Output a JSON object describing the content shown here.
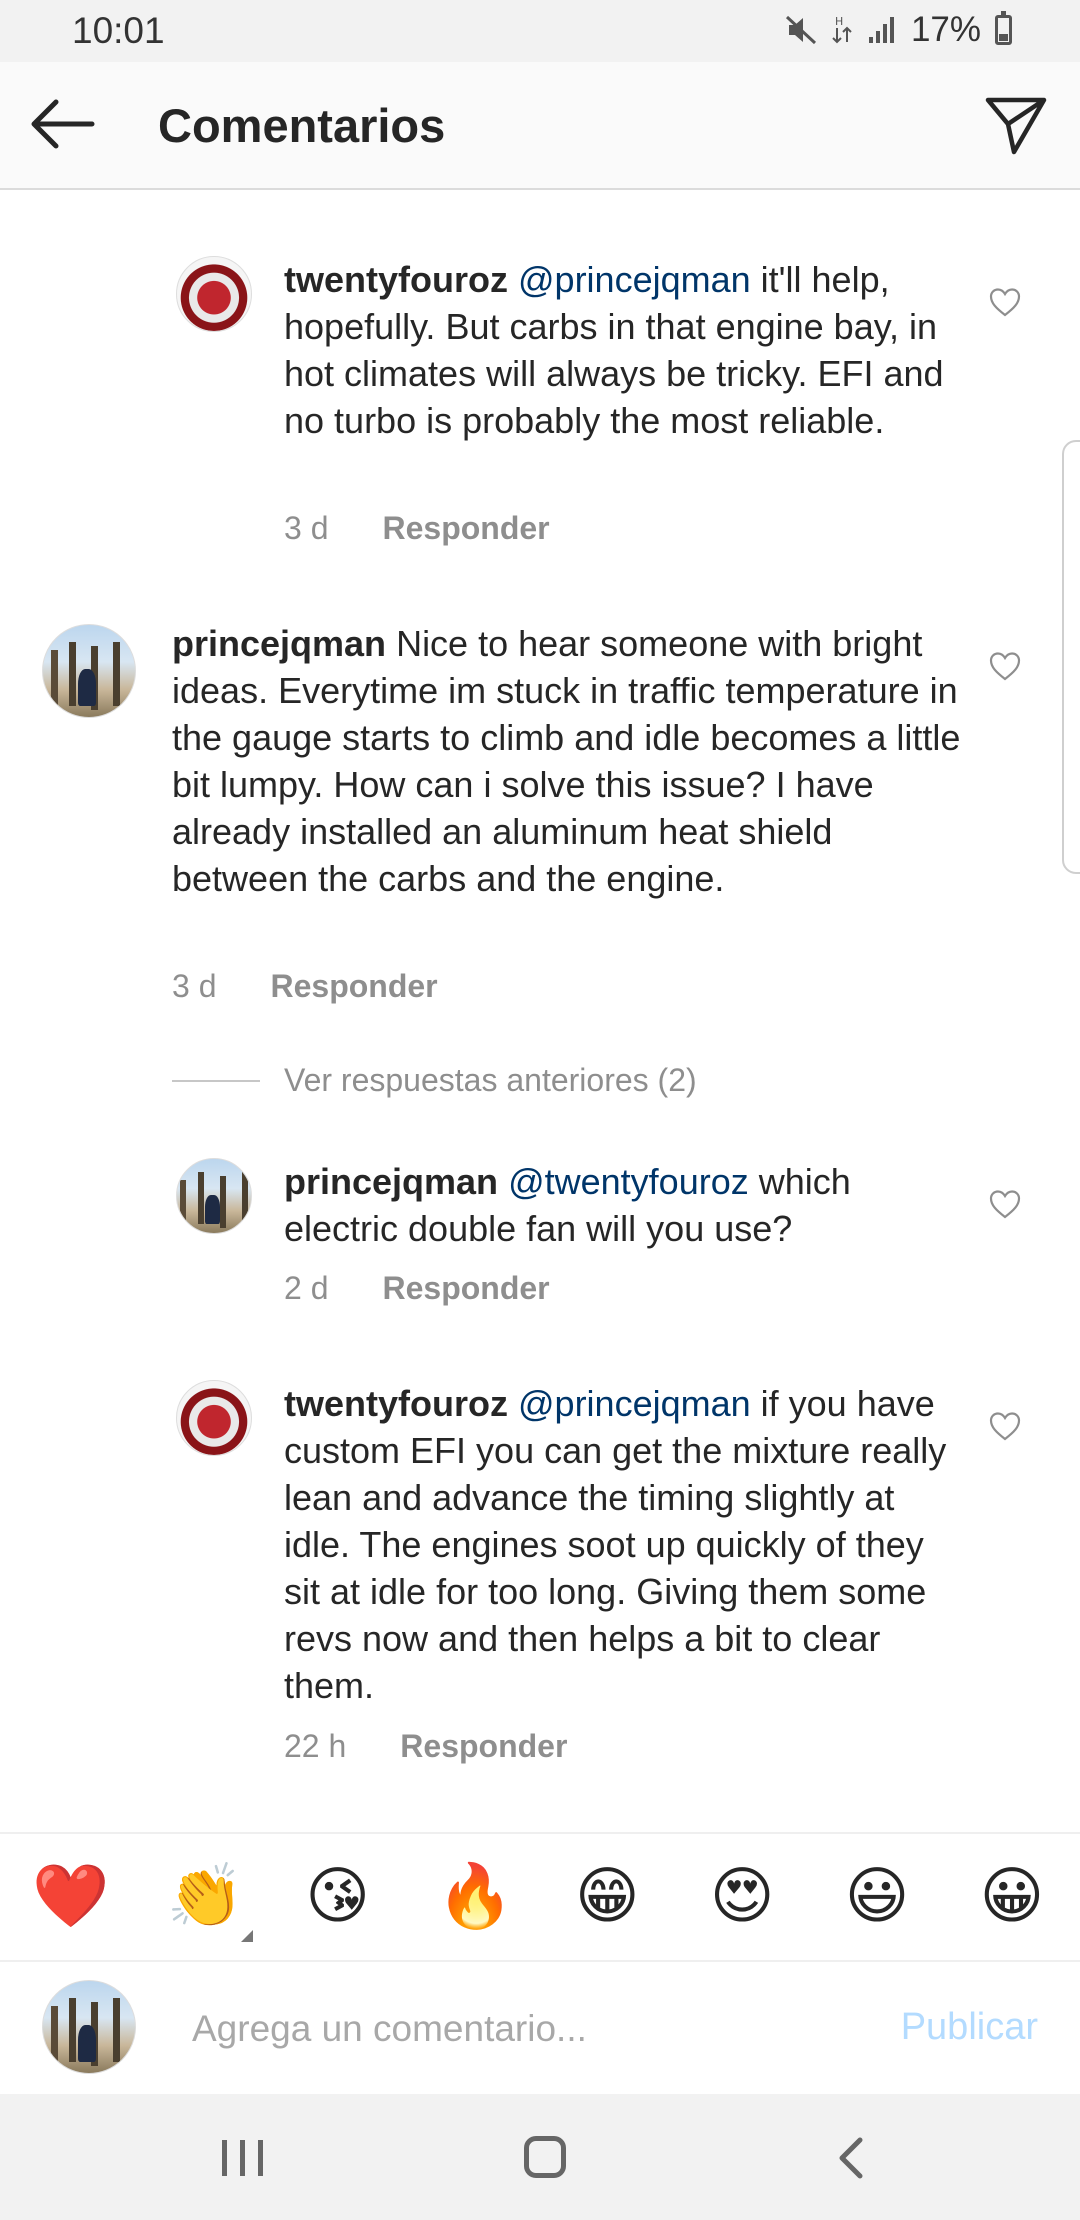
{
  "status_bar": {
    "time": "10:01",
    "battery": "17%"
  },
  "header": {
    "title": "Comentarios"
  },
  "comments": [
    {
      "user": "twentyfouroz",
      "mention": "@princejqman",
      "text": " it'll help, hopefully. But carbs in that engine bay, in hot climates will always be tricky. EFI and no turbo is probably the most reliable.",
      "time": "3 d",
      "reply": "Responder"
    },
    {
      "user": "princejqman",
      "mention": "",
      "text": " Nice to hear someone with bright ideas. Everytime im stuck in traffic temperature in the gauge starts to climb and idle becomes a little bit lumpy. How can i solve this issue? I have already installed an aluminum heat shield between the carbs and the engine.",
      "time": "3 d",
      "reply": "Responder"
    },
    {
      "user": "princejqman",
      "mention": "@twentyfouroz",
      "text": " which electric double fan will you use?",
      "time": "2 d",
      "reply": "Responder"
    },
    {
      "user": "twentyfouroz",
      "mention": "@princejqman",
      "text": " if you have custom  EFI you can get the mixture really lean and advance the timing slightly at idle. The engines soot up quickly of they sit at idle for too long. Giving them some revs now and then helps a bit to clear them.",
      "time": "22 h",
      "reply": "Responder"
    }
  ],
  "view_previous": "Ver respuestas anteriores (2)",
  "emoji_bar": [
    "❤️",
    "👏",
    "😘",
    "🔥",
    "😁",
    "😍",
    "😃",
    "😀"
  ],
  "comment_input": {
    "placeholder": "Agrega un comentario...",
    "post_label": "Publicar"
  },
  "colors": {
    "mention": "#003569",
    "muted": "#8e8e8e",
    "post_disabled": "#b3dbff"
  }
}
